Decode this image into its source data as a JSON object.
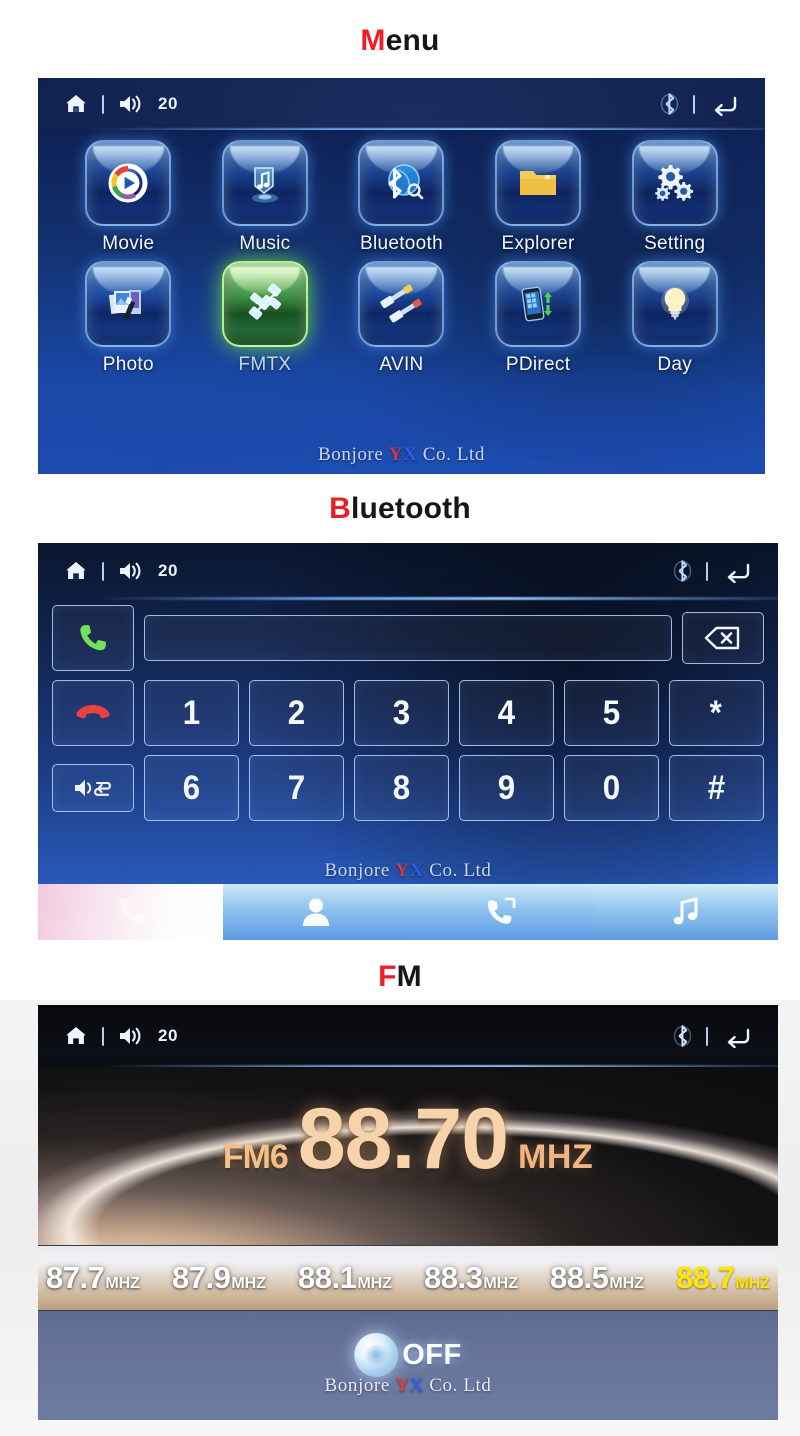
{
  "sections": [
    {
      "caption_hl": "M",
      "caption_rest": "enu"
    },
    {
      "caption_hl": "B",
      "caption_rest": "luetooth"
    },
    {
      "caption_hl": "F",
      "caption_rest": "M"
    }
  ],
  "statusbar": {
    "home_icon": "home-icon",
    "separator": "|",
    "volume_icon": "volume-icon",
    "volume_value": "20",
    "bluetooth_icon": "bluetooth-icon",
    "back_icon": "back-arrow-icon"
  },
  "watermark": {
    "prefix": "Bonjore ",
    "y": "Y",
    "x": "X",
    "suffix": " Co. Ltd"
  },
  "menu": {
    "tiles": [
      {
        "label": "Movie",
        "icon": "movie-play-icon",
        "active": false
      },
      {
        "label": "Music",
        "icon": "music-note-icon",
        "active": false
      },
      {
        "label": "Bluetooth",
        "icon": "bluetooth-icon",
        "active": false
      },
      {
        "label": "Explorer",
        "icon": "folder-icon",
        "active": false
      },
      {
        "label": "Setting",
        "icon": "gears-icon",
        "active": false
      },
      {
        "label": "Photo",
        "icon": "photo-icon",
        "active": false
      },
      {
        "label": "FMTX",
        "icon": "satellite-icon",
        "active": true
      },
      {
        "label": "AVIN",
        "icon": "rca-plugs-icon",
        "active": false
      },
      {
        "label": "PDirect",
        "icon": "phone-sync-icon",
        "active": false
      },
      {
        "label": "Day",
        "icon": "light-bulb-icon",
        "active": false
      }
    ]
  },
  "bluetooth": {
    "call_button_icon": "call-answer-icon",
    "hangup_button_icon": "call-hangup-icon",
    "audio_transfer_icon": "audio-transfer-icon",
    "backspace_icon": "backspace-icon",
    "number_field_value": "",
    "number_field_placeholder": "",
    "keys_row1": [
      "1",
      "2",
      "3",
      "4",
      "5",
      "*"
    ],
    "keys_row2": [
      "6",
      "7",
      "8",
      "9",
      "0",
      "#"
    ],
    "tabs": [
      {
        "icon": "dialpad-phone-icon",
        "name": "tab-dialer",
        "active": true
      },
      {
        "icon": "contact-person-icon",
        "name": "tab-contacts",
        "active": false
      },
      {
        "icon": "call-history-icon",
        "name": "tab-history",
        "active": false
      },
      {
        "icon": "music-note-icon",
        "name": "tab-music",
        "active": false
      }
    ]
  },
  "fm": {
    "band_label": "FM6",
    "frequency": "88.70",
    "unit": "MHZ",
    "presets": [
      {
        "value": "87.7",
        "unit": "MHZ",
        "active": false
      },
      {
        "value": "87.9",
        "unit": "MHZ",
        "active": false
      },
      {
        "value": "88.1",
        "unit": "MHZ",
        "active": false
      },
      {
        "value": "88.3",
        "unit": "MHZ",
        "active": false
      },
      {
        "value": "88.5",
        "unit": "MHZ",
        "active": false
      },
      {
        "value": "88.7",
        "unit": "MHZ",
        "active": true
      }
    ],
    "power_toggle": {
      "label": "OFF",
      "icon": "power-orb-icon"
    }
  },
  "colors": {
    "accent_red": "#ee1c25",
    "active_tile_green": "#5ec832",
    "fm_text_orange": "#f7d3ab",
    "preset_active_yellow": "#ffe600"
  }
}
